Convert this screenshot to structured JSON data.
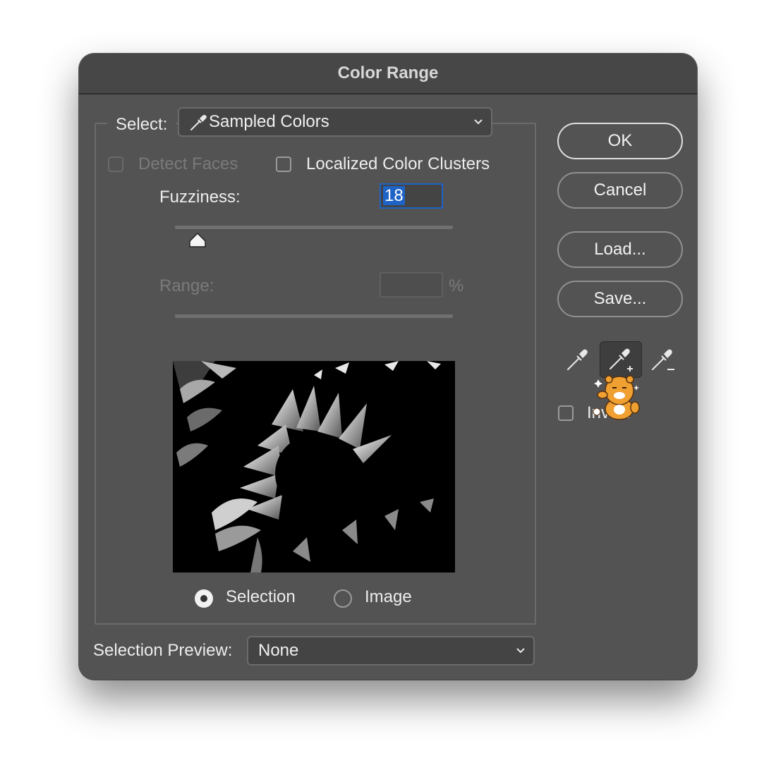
{
  "dialog": {
    "title": "Color Range"
  },
  "select": {
    "label": "Select:",
    "value": "Sampled Colors",
    "value_icon": "eyedropper-icon"
  },
  "options": {
    "detect_faces_label": "Detect Faces",
    "detect_faces_checked": false,
    "detect_faces_enabled": false,
    "localized_label": "Localized Color Clusters",
    "localized_checked": false
  },
  "fuzziness": {
    "label": "Fuzziness:",
    "value": "18",
    "slider_fraction": 0.08
  },
  "range": {
    "label": "Range:",
    "value": "",
    "unit": "%"
  },
  "view": {
    "selection_label": "Selection",
    "image_label": "Image",
    "selected": "selection"
  },
  "selection_preview": {
    "label": "Selection Preview:",
    "value": "None"
  },
  "buttons": {
    "ok": "OK",
    "cancel": "Cancel",
    "load": "Load...",
    "save": "Save..."
  },
  "tools": [
    {
      "name": "eyedropper-icon",
      "active": false
    },
    {
      "name": "eyedropper-plus-icon",
      "active": true
    },
    {
      "name": "eyedropper-minus-icon",
      "active": false
    }
  ],
  "invert": {
    "label": "Invert",
    "checked": false
  },
  "colors": {
    "dialog_bg": "#535353",
    "focus_blue": "#1e63c6",
    "mascot_orange": "#f0a030"
  }
}
